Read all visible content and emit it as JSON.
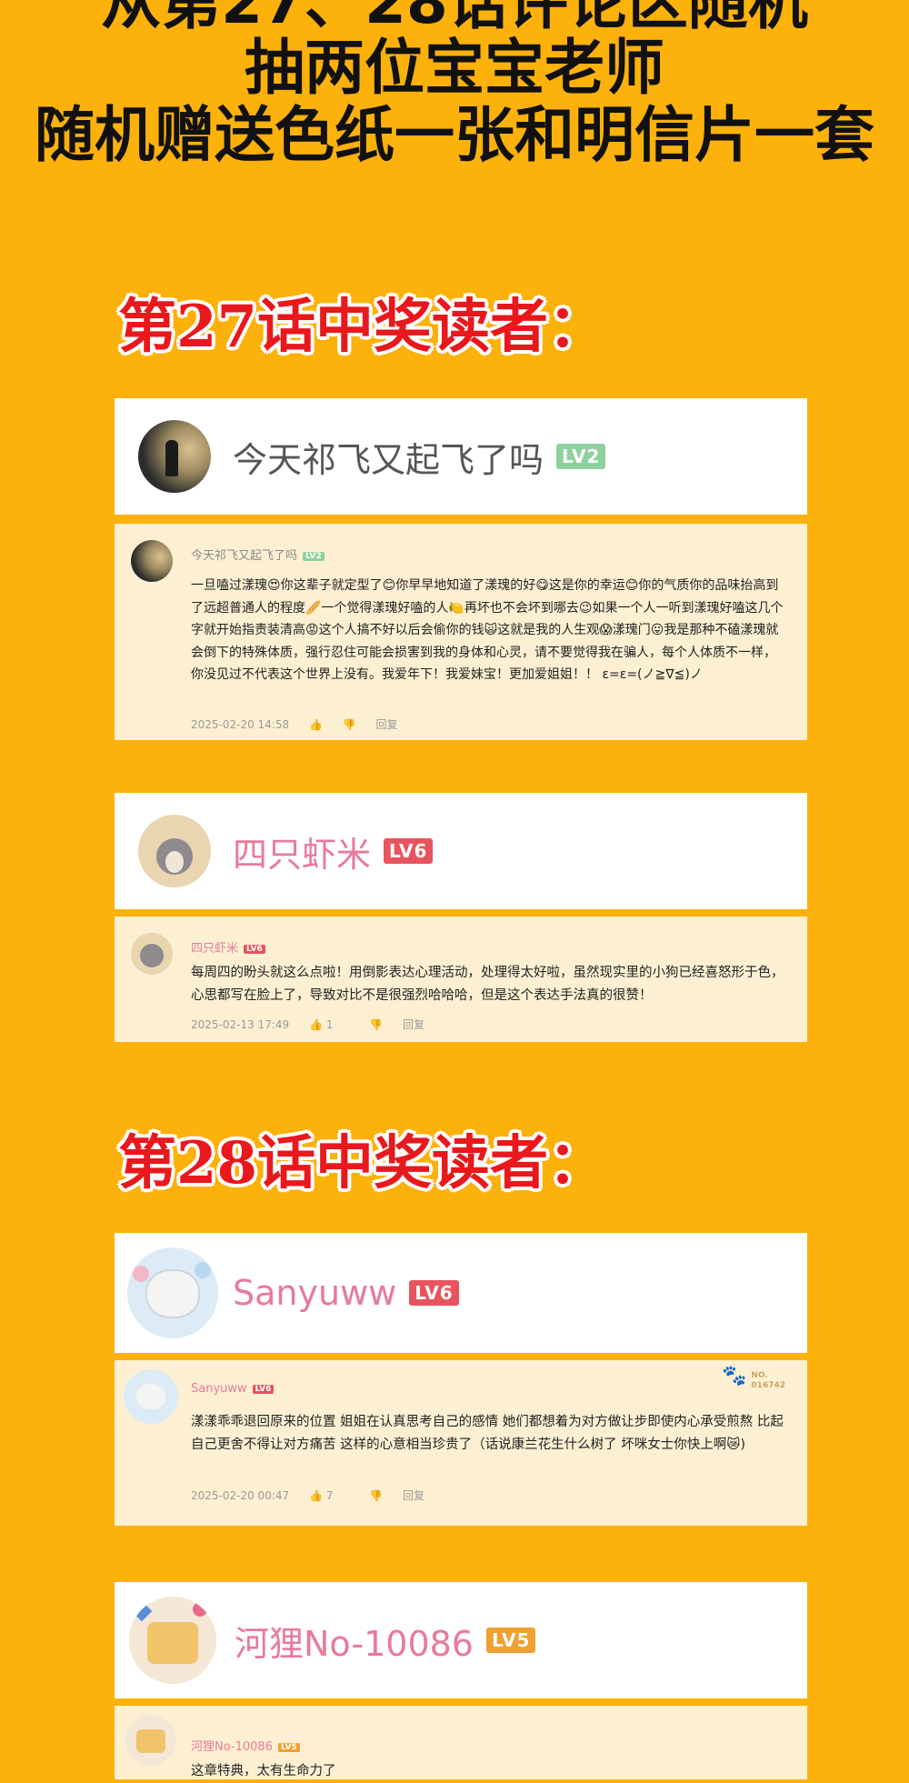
{
  "headline": {
    "line1": "从第27、28话评论区随机",
    "line2": "抽两位宝宝老师",
    "line3": "随机赠送色纸一张和明信片一套"
  },
  "sections": [
    {
      "title": "第27话中奖读者："
    },
    {
      "title": "第28话中奖读者："
    }
  ],
  "winners": [
    {
      "name": "今天祁飞又起飞了吗",
      "level": "LV2",
      "level_color": "#8FD19E",
      "name_color": "#555555",
      "comment_name_color": "#888888",
      "comment": "一旦嗑过漾瑰😍你这辈子就定型了😊你早早地知道了漾瑰的好😋这是你的幸运😊你的气质你的品味抬高到了远超普通人的程度🥖一个觉得漾瑰好嗑的人🍋再坏也不会坏到哪去😉如果一个人一听到漾瑰好嗑这几个字就开始指责装清高😡这个人搞不好以后会偷你的钱🙀这就是我的人生观😱漾瑰门😛我是那种不磕漾瑰就会倒下的特殊体质，强行忍住可能会损害到我的身体和心灵，请不要觉得我在骗人，每个人体质不一样，你没见过不代表这个世界上没有。我爱年下！我爱妹宝！更加爱姐姐！！ ε=ε=(ノ≧∇≦)ノ",
      "date": "2025-02-20 14:58",
      "likes": "",
      "dislike_icon": "dislike-icon",
      "reply": "回复"
    },
    {
      "name": "四只虾米",
      "level": "LV6",
      "level_color": "#E8545E",
      "name_color": "#E87A9A",
      "comment_name_color": "#E87A9A",
      "comment": "每周四的盼头就这么点啦！用倒影表达心理活动，处理得太好啦，虽然现实里的小狗已经喜怒形于色，心思都写在脸上了，导致对比不是很强烈哈哈哈，但是这个表达手法真的很赞！",
      "date": "2025-02-13 17:49",
      "likes": "1",
      "reply": "回复"
    },
    {
      "name": "Sanyuww",
      "level": "LV6",
      "level_color": "#E8545E",
      "name_color": "#E87A9A",
      "comment_name_color": "#E87A9A",
      "comment": "漾漾乖乖退回原来的位置 姐姐在认真思考自己的感情 她们都想着为对方做让步即使内心承受煎熬 比起自己更舍不得让对方痛苦 这样的心意相当珍贵了（话说康兰花生什么树了 坏咪女士你快上啊😿)",
      "date": "2025-02-20 00:47",
      "likes": "7",
      "reply": "回复",
      "badge_top": "NO.",
      "badge_bottom": "016742"
    },
    {
      "name": "河狸No-10086",
      "level": "LV5",
      "level_color": "#F0A030",
      "name_color": "#E87A9A",
      "comment_name_color": "#E87A9A",
      "comment": "这章特典，太有生命力了",
      "date": "",
      "likes": "",
      "reply": ""
    }
  ],
  "colors": {
    "background": "#FDB10B",
    "section_title": "#E8181C",
    "comment_bg": "#FDF0D2"
  }
}
